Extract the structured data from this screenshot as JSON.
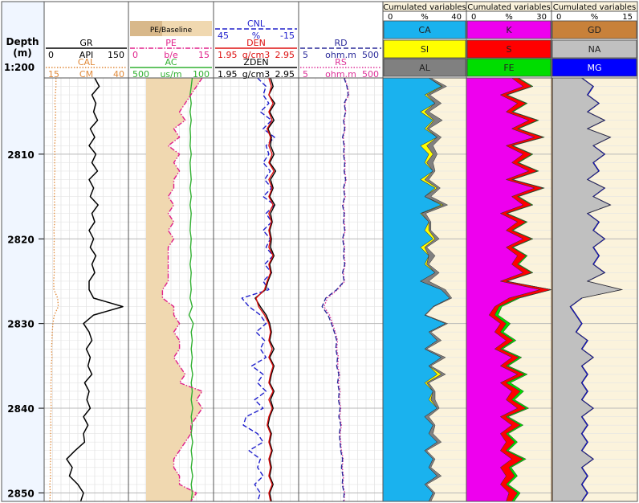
{
  "depth_track": {
    "title": "Depth",
    "unit": "(m)",
    "scale": "1:200"
  },
  "depth_range": [
    2801,
    2851
  ],
  "depth_ticks": [
    2810,
    2820,
    2830,
    2840,
    2850
  ],
  "colors": {
    "GR": "#000000",
    "CAL": "#e08a3a",
    "PE": "#e0208a",
    "AC": "#30b030",
    "CNL": "#2020cc",
    "DEN": "#dd1111",
    "ZDEN": "#000000",
    "RD": "#2a2a99",
    "RS": "#dd3399",
    "PE_baseline": "#f0d8b0",
    "CA": "#1ab2ee",
    "SI": "#ffff00",
    "AL": "#808080",
    "K": "#ee00ee",
    "S": "#ff0000",
    "FE": "#00dd00",
    "GD": "#c8813a",
    "NA": "#c0c0c0",
    "MG": "#0000ff",
    "cum_bg": "#fbf3dc"
  },
  "tracks": [
    {
      "id": "t1",
      "curves": [
        {
          "name": "GR",
          "unit": "API",
          "min": "0",
          "max": "150",
          "style": "solid"
        },
        {
          "name": "CAL",
          "unit": "CM",
          "min": "15",
          "max": "40",
          "style": "dotted"
        }
      ]
    },
    {
      "id": "t2",
      "fill_label": "PE/Baseline",
      "curves": [
        {
          "name": "PE",
          "unit": "b/e",
          "min": "0",
          "max": "15",
          "style": "dashdot"
        },
        {
          "name": "AC",
          "unit": "us/m",
          "min": "500",
          "max": "100",
          "style": "solid"
        }
      ]
    },
    {
      "id": "t3",
      "curves": [
        {
          "name": "CNL",
          "unit": "%",
          "min": "45",
          "max": "-15",
          "style": "dashed"
        },
        {
          "name": "DEN",
          "unit": "g/cm3",
          "min": "1.95",
          "max": "2.95",
          "style": "solid"
        },
        {
          "name": "ZDEN",
          "unit": "g/cm3",
          "min": "1.95",
          "max": "2.95",
          "style": "solid"
        }
      ]
    },
    {
      "id": "t4",
      "curves": [
        {
          "name": "RD",
          "unit": "ohm.m",
          "min": "5",
          "max": "500",
          "style": "dashed"
        },
        {
          "name": "RS",
          "unit": "ohm.m",
          "min": "5",
          "max": "500",
          "style": "dotted"
        }
      ]
    }
  ],
  "cum_tracks": [
    {
      "title": "Cumulated variables",
      "unit": "%",
      "min": "0",
      "max": "40",
      "components": [
        "CA",
        "SI",
        "AL"
      ]
    },
    {
      "title": "Cumulated variables",
      "unit": "%",
      "min": "0",
      "max": "30",
      "components": [
        "K",
        "S",
        "FE"
      ]
    },
    {
      "title": "Cumulated variables",
      "unit": "%",
      "min": "0",
      "max": "15",
      "components": [
        "GD",
        "NA",
        "MG"
      ]
    }
  ],
  "chart_data": {
    "type": "line",
    "depth": [
      2801,
      2802,
      2803,
      2804,
      2805,
      2806,
      2807,
      2808,
      2809,
      2810,
      2811,
      2812,
      2813,
      2814,
      2815,
      2816,
      2817,
      2818,
      2819,
      2820,
      2821,
      2822,
      2823,
      2824,
      2825,
      2826,
      2827,
      2828,
      2829,
      2830,
      2831,
      2832,
      2833,
      2834,
      2835,
      2836,
      2837,
      2838,
      2839,
      2840,
      2841,
      2842,
      2843,
      2844,
      2845,
      2846,
      2847,
      2848,
      2849,
      2850,
      2851
    ],
    "series": [
      {
        "name": "GR",
        "values": [
          90,
          98,
          85,
          92,
          88,
          95,
          82,
          90,
          80,
          92,
          85,
          95,
          80,
          88,
          82,
          96,
          85,
          90,
          80,
          88,
          82,
          92,
          85,
          90,
          80,
          80,
          88,
          140,
          88,
          70,
          80,
          85,
          75,
          82,
          78,
          85,
          72,
          80,
          76,
          82,
          70,
          78,
          70,
          72,
          55,
          40,
          50,
          45,
          60,
          70,
          65
        ]
      },
      {
        "name": "CAL",
        "values": [
          18.5,
          18.5,
          18.3,
          18.2,
          18.4,
          18.3,
          18.2,
          18.3,
          18.1,
          18.2,
          18.1,
          18.2,
          18,
          18.1,
          18,
          18.1,
          18,
          18.1,
          17.9,
          18,
          17.9,
          18,
          17.9,
          18,
          17.8,
          17.9,
          19,
          19.2,
          18,
          17.6,
          17.4,
          17.3,
          17.2,
          17.3,
          17.1,
          17.2,
          17,
          17.1,
          17,
          17.1,
          16.9,
          17,
          16.9,
          17,
          16.8,
          16.9,
          16.8,
          16.9,
          16.7,
          16.8,
          16.7
        ]
      },
      {
        "name": "PE",
        "values": [
          13,
          12,
          11,
          10,
          9,
          10,
          8,
          9,
          7,
          9,
          8,
          9,
          8,
          8,
          7,
          8,
          7,
          8,
          7,
          8,
          7,
          7,
          7,
          7,
          7,
          6,
          6,
          8,
          8,
          9,
          8,
          9,
          9,
          8,
          9,
          10,
          9,
          13,
          12,
          13,
          12,
          11,
          11,
          10,
          9,
          8,
          8,
          9,
          9,
          12,
          11
        ]
      },
      {
        "name": "AC",
        "values": [
          200,
          205,
          210,
          205,
          210,
          205,
          210,
          208,
          210,
          205,
          210,
          208,
          205,
          210,
          205,
          210,
          205,
          208,
          210,
          205,
          208,
          205,
          210,
          205,
          208,
          205,
          210,
          200,
          215,
          195,
          205,
          200,
          205,
          200,
          205,
          198,
          205,
          200,
          205,
          198,
          205,
          200,
          205,
          198,
          205,
          200,
          205,
          198,
          205,
          200,
          205
        ]
      },
      {
        "name": "CNL",
        "values": [
          14,
          8,
          10,
          6,
          12,
          4,
          10,
          2,
          8,
          6,
          10,
          5,
          9,
          4,
          10,
          2,
          8,
          4,
          10,
          5,
          8,
          3,
          9,
          4,
          10,
          6,
          25,
          20,
          12,
          8,
          15,
          9,
          12,
          8,
          18,
          10,
          14,
          8,
          16,
          10,
          22,
          24,
          14,
          10,
          20,
          12,
          14,
          10,
          16,
          12,
          14
        ]
      },
      {
        "name": "DEN",
        "values": [
          2.6,
          2.63,
          2.6,
          2.65,
          2.6,
          2.64,
          2.58,
          2.62,
          2.6,
          2.64,
          2.6,
          2.66,
          2.6,
          2.64,
          2.6,
          2.65,
          2.6,
          2.63,
          2.6,
          2.62,
          2.6,
          2.65,
          2.6,
          2.62,
          2.58,
          2.55,
          2.45,
          2.48,
          2.55,
          2.6,
          2.62,
          2.6,
          2.64,
          2.6,
          2.65,
          2.62,
          2.6,
          2.65,
          2.6,
          2.64,
          2.6,
          2.58,
          2.62,
          2.6,
          2.63,
          2.6,
          2.62,
          2.6,
          2.64,
          2.6,
          2.62
        ]
      },
      {
        "name": "ZDEN",
        "values": [
          2.62,
          2.65,
          2.6,
          2.67,
          2.61,
          2.66,
          2.59,
          2.63,
          2.62,
          2.66,
          2.61,
          2.68,
          2.62,
          2.65,
          2.61,
          2.67,
          2.62,
          2.64,
          2.61,
          2.63,
          2.62,
          2.66,
          2.61,
          2.63,
          2.59,
          2.56,
          2.44,
          2.5,
          2.57,
          2.61,
          2.63,
          2.61,
          2.66,
          2.61,
          2.66,
          2.63,
          2.61,
          2.66,
          2.62,
          2.65,
          2.61,
          2.59,
          2.63,
          2.61,
          2.64,
          2.61,
          2.63,
          2.61,
          2.65,
          2.61,
          2.63
        ]
      },
      {
        "name": "RD",
        "values": [
          60,
          70,
          75,
          60,
          65,
          58,
          62,
          55,
          60,
          58,
          62,
          60,
          65,
          58,
          62,
          55,
          60,
          58,
          62,
          55,
          60,
          58,
          62,
          55,
          60,
          40,
          22,
          18,
          25,
          30,
          35,
          40,
          38,
          42,
          40,
          45,
          42,
          46,
          44,
          48,
          45,
          50,
          46,
          48,
          50,
          55,
          52,
          56,
          54,
          60,
          58
        ]
      },
      {
        "name": "RS",
        "values": [
          62,
          72,
          78,
          62,
          66,
          60,
          64,
          57,
          62,
          60,
          64,
          62,
          67,
          60,
          64,
          57,
          62,
          60,
          64,
          57,
          62,
          60,
          64,
          57,
          62,
          42,
          24,
          20,
          27,
          32,
          37,
          42,
          40,
          44,
          42,
          47,
          44,
          48,
          46,
          50,
          47,
          52,
          48,
          50,
          52,
          57,
          54,
          58,
          56,
          62,
          60
        ]
      },
      {
        "name": "CA",
        "values": [
          22,
          28,
          20,
          25,
          18,
          24,
          20,
          26,
          18,
          22,
          20,
          24,
          18,
          25,
          20,
          28,
          18,
          22,
          20,
          24,
          18,
          22,
          20,
          25,
          18,
          28,
          32,
          24,
          20,
          30,
          22,
          26,
          20,
          28,
          22,
          26,
          20,
          24,
          22,
          26,
          20,
          24,
          22,
          26,
          20,
          24,
          22,
          26,
          20,
          24,
          22
        ]
      },
      {
        "name": "SI",
        "values": [
          0,
          0.5,
          1,
          0,
          2,
          0.5,
          1,
          0,
          3,
          2,
          1,
          0,
          2,
          1,
          0,
          1,
          0.5,
          0,
          2,
          1,
          2,
          0,
          1,
          0,
          0,
          0,
          0,
          0,
          0,
          0,
          0,
          0,
          0,
          0,
          0,
          2,
          1,
          0,
          1,
          0,
          0,
          0,
          0,
          0,
          0,
          0,
          0,
          0,
          0,
          0,
          0
        ]
      },
      {
        "name": "AL",
        "values": [
          1,
          2,
          1.5,
          3,
          2,
          4,
          1,
          2,
          3,
          2,
          3,
          1,
          2,
          1.5,
          3,
          2,
          2,
          1,
          1,
          2,
          1,
          3,
          1,
          2,
          4,
          2,
          1,
          0.5,
          0.5,
          1,
          1,
          2,
          1,
          2,
          1,
          2,
          1,
          1,
          2,
          1,
          2,
          1,
          2,
          2,
          1,
          1,
          1,
          2,
          1,
          1,
          1
        ]
      },
      {
        "name": "FE",
        "values": [
          0.5,
          0.5,
          0.5,
          0.5,
          0.5,
          0.5,
          0.5,
          0.5,
          0.5,
          0.5,
          0.5,
          0.5,
          0.5,
          0.5,
          0.5,
          0.5,
          0.5,
          0.5,
          0.5,
          0.5,
          0.5,
          0.5,
          0.5,
          0.5,
          0.5,
          0.5,
          0.8,
          1,
          1.2,
          1.5,
          1,
          1,
          0.8,
          1,
          0.8,
          1,
          1.5,
          1.2,
          1,
          1,
          0.8,
          1,
          0.8,
          1,
          0.8,
          1,
          0.8,
          1,
          0.8,
          1,
          0.8
        ]
      },
      {
        "name": "S",
        "values": [
          2,
          3,
          2,
          3,
          2,
          3,
          2,
          3,
          2,
          3,
          2,
          3,
          2,
          3,
          2,
          3,
          2,
          3,
          2,
          3,
          2,
          3,
          2,
          3,
          2,
          4,
          3,
          1.5,
          2,
          2,
          2,
          2.5,
          2,
          2.5,
          2,
          2.5,
          2,
          3,
          2,
          3,
          2,
          3,
          2,
          3,
          2,
          4,
          3,
          3,
          2,
          3,
          2
        ]
      },
      {
        "name": "K",
        "values": [
          16,
          20,
          12,
          18,
          14,
          22,
          16,
          24,
          14,
          20,
          16,
          22,
          14,
          24,
          16,
          20,
          12,
          18,
          14,
          20,
          14,
          18,
          16,
          20,
          12,
          26,
          15,
          10,
          8,
          12,
          10,
          14,
          10,
          16,
          12,
          18,
          12,
          16,
          14,
          18,
          12,
          16,
          12,
          14,
          12,
          16,
          12,
          14,
          12,
          15,
          14
        ]
      },
      {
        "name": "GD",
        "values": [
          0.2,
          0.2,
          0.2,
          0.2,
          0.2,
          0.2,
          0.2,
          0.2,
          0.2,
          0.2,
          0.2,
          0.2,
          0.2,
          0.2,
          0.2,
          0.2,
          0.2,
          0.2,
          0.2,
          0.2,
          0.2,
          0.2,
          0.2,
          0.2,
          0.2,
          0.2,
          0.2,
          0.2,
          0.2,
          0.2,
          0.2,
          0.2,
          0.2,
          0.2,
          0.2,
          0.2,
          0.2,
          0.2,
          0.2,
          0.2,
          0.2,
          0.2,
          0.2,
          0.2,
          0.2,
          0.2,
          0.2,
          0.2,
          0.2,
          0.2,
          0.2
        ]
      },
      {
        "name": "NA",
        "values": [
          5,
          7,
          6,
          8,
          6,
          9,
          6,
          10,
          7,
          9,
          7,
          8,
          6,
          9,
          7,
          10,
          6,
          8,
          7,
          9,
          7,
          8,
          7,
          9,
          6,
          12,
          5,
          3,
          4,
          5,
          4,
          6,
          5,
          7,
          5,
          6,
          5,
          6,
          5,
          7,
          5,
          6,
          5,
          6,
          5,
          7,
          5,
          6,
          5,
          6,
          5
        ]
      },
      {
        "name": "MG",
        "values": [
          0.2,
          0.2,
          0.2,
          0.2,
          0.2,
          0.2,
          0.2,
          0.2,
          0.2,
          0.2,
          0.2,
          0.2,
          0.2,
          0.2,
          0.2,
          0.2,
          0.2,
          0.2,
          0.2,
          0.2,
          0.2,
          0.2,
          0.2,
          0.2,
          0.2,
          0.2,
          0.2,
          0.2,
          0.2,
          0.2,
          0.2,
          0.2,
          0.2,
          0.2,
          0.2,
          0.2,
          0.2,
          0.2,
          0.2,
          0.2,
          0.2,
          0.2,
          0.2,
          0.2,
          0.2,
          0.2,
          0.2,
          0.2,
          0.2,
          0.2,
          0.2
        ]
      }
    ]
  }
}
